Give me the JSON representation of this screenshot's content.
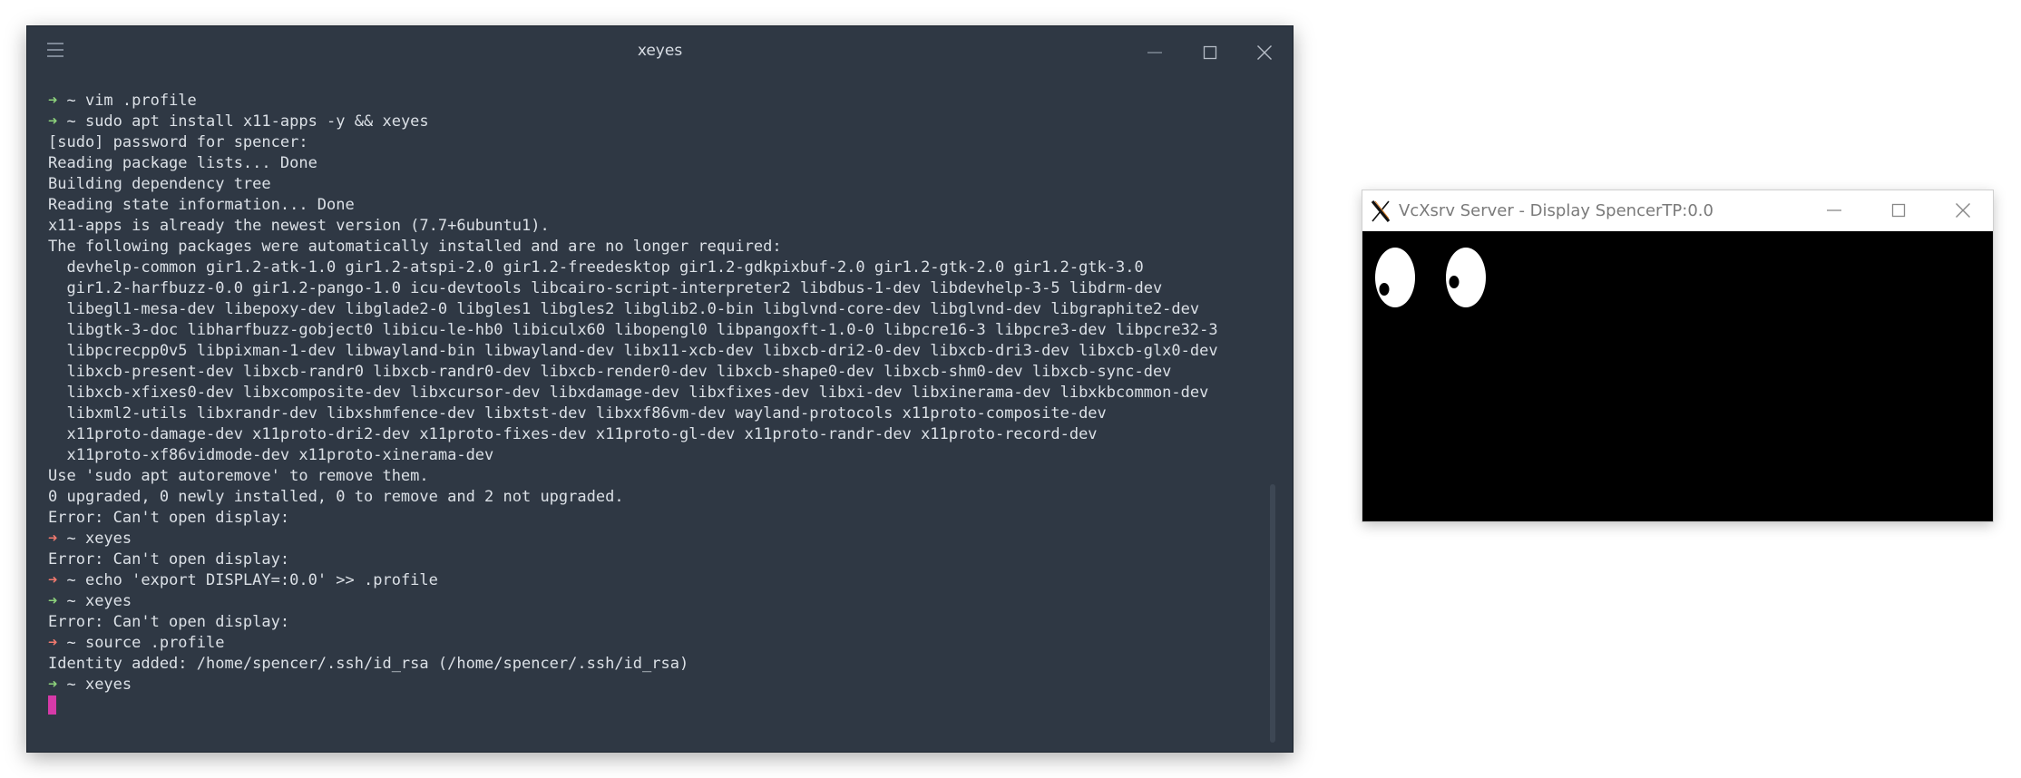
{
  "terminal": {
    "title": "xeyes",
    "lines": [
      {
        "prompt": "ok",
        "text": " ~ vim .profile"
      },
      {
        "prompt": "ok",
        "text": " ~ sudo apt install x11-apps -y && xeyes"
      },
      {
        "text": "[sudo] password for spencer:"
      },
      {
        "text": "Reading package lists... Done"
      },
      {
        "text": "Building dependency tree"
      },
      {
        "text": "Reading state information... Done"
      },
      {
        "text": "x11-apps is already the newest version (7.7+6ubuntu1)."
      },
      {
        "text": "The following packages were automatically installed and are no longer required:"
      },
      {
        "text": "  devhelp-common gir1.2-atk-1.0 gir1.2-atspi-2.0 gir1.2-freedesktop gir1.2-gdkpixbuf-2.0 gir1.2-gtk-2.0 gir1.2-gtk-3.0"
      },
      {
        "text": "  gir1.2-harfbuzz-0.0 gir1.2-pango-1.0 icu-devtools libcairo-script-interpreter2 libdbus-1-dev libdevhelp-3-5 libdrm-dev"
      },
      {
        "text": "  libegl1-mesa-dev libepoxy-dev libglade2-0 libgles1 libgles2 libglib2.0-bin libglvnd-core-dev libglvnd-dev libgraphite2-dev"
      },
      {
        "text": "  libgtk-3-doc libharfbuzz-gobject0 libicu-le-hb0 libiculx60 libopengl0 libpangoxft-1.0-0 libpcre16-3 libpcre3-dev libpcre32-3"
      },
      {
        "text": "  libpcrecpp0v5 libpixman-1-dev libwayland-bin libwayland-dev libx11-xcb-dev libxcb-dri2-0-dev libxcb-dri3-dev libxcb-glx0-dev"
      },
      {
        "text": "  libxcb-present-dev libxcb-randr0 libxcb-randr0-dev libxcb-render0-dev libxcb-shape0-dev libxcb-shm0-dev libxcb-sync-dev"
      },
      {
        "text": "  libxcb-xfixes0-dev libxcomposite-dev libxcursor-dev libxdamage-dev libxfixes-dev libxi-dev libxinerama-dev libxkbcommon-dev"
      },
      {
        "text": "  libxml2-utils libxrandr-dev libxshmfence-dev libxtst-dev libxxf86vm-dev wayland-protocols x11proto-composite-dev"
      },
      {
        "text": "  x11proto-damage-dev x11proto-dri2-dev x11proto-fixes-dev x11proto-gl-dev x11proto-randr-dev x11proto-record-dev"
      },
      {
        "text": "  x11proto-xf86vidmode-dev x11proto-xinerama-dev"
      },
      {
        "text": "Use 'sudo apt autoremove' to remove them."
      },
      {
        "text": "0 upgraded, 0 newly installed, 0 to remove and 2 not upgraded."
      },
      {
        "text": "Error: Can't open display:"
      },
      {
        "prompt": "err",
        "text": " ~ xeyes"
      },
      {
        "text": "Error: Can't open display:"
      },
      {
        "prompt": "err",
        "text": " ~ echo 'export DISPLAY=:0.0' >> .profile"
      },
      {
        "prompt": "ok",
        "text": " ~ xeyes"
      },
      {
        "text": "Error: Can't open display:"
      },
      {
        "prompt": "err",
        "text": " ~ source .profile"
      },
      {
        "text": "Identity added: /home/spencer/.ssh/id_rsa (/home/spencer/.ssh/id_rsa)"
      },
      {
        "prompt": "ok",
        "text": " ~ xeyes"
      },
      {
        "cursor": true
      }
    ]
  },
  "xserver": {
    "title": "VcXsrv Server - Display SpencerTP:0.0",
    "app_icon": "x-logo-icon"
  },
  "colors": {
    "terminal_bg": "#2f3844",
    "prompt_ok": "#8cd17b",
    "prompt_err": "#f0796e",
    "cursor": "#d63aa8"
  }
}
